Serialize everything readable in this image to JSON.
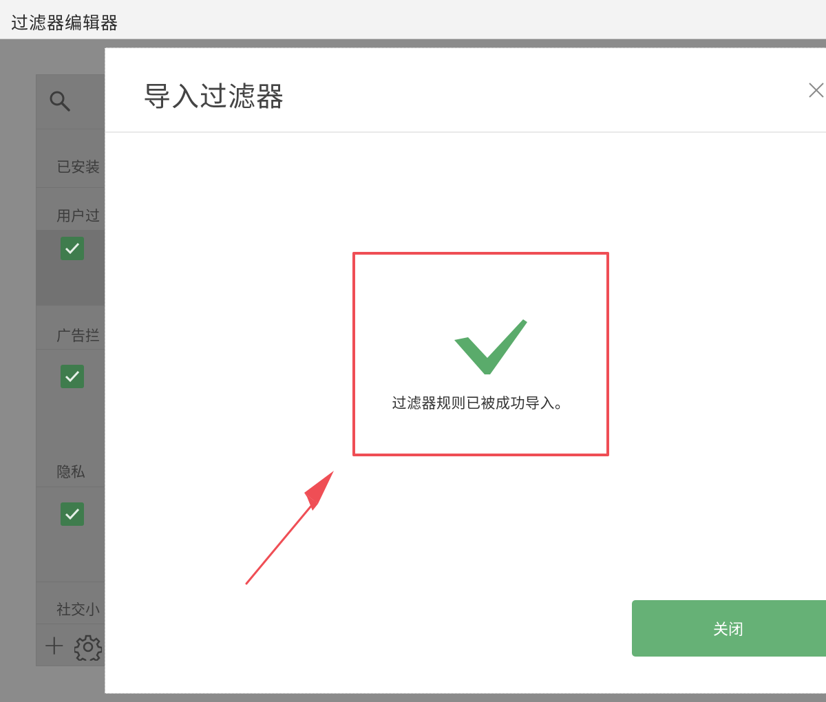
{
  "window": {
    "title": "过滤器编辑器"
  },
  "background": {
    "search_icon": "search-icon",
    "sections": [
      {
        "label": "已安装"
      },
      {
        "label": "用户过"
      },
      {
        "label": "广告拦"
      },
      {
        "label": "隐私"
      },
      {
        "label": "社交小"
      }
    ],
    "footer": {
      "add_icon": "plus-icon",
      "settings_icon": "gear-icon"
    }
  },
  "dialog": {
    "title": "导入过滤器",
    "close_icon": "close-icon",
    "success_icon": "checkmark-icon",
    "message": "过滤器规则已被成功导入。",
    "close_button_label": "关闭"
  },
  "colors": {
    "success_green": "#5aab6b",
    "button_green": "#66b176",
    "highlight_red": "#ef4e55"
  }
}
